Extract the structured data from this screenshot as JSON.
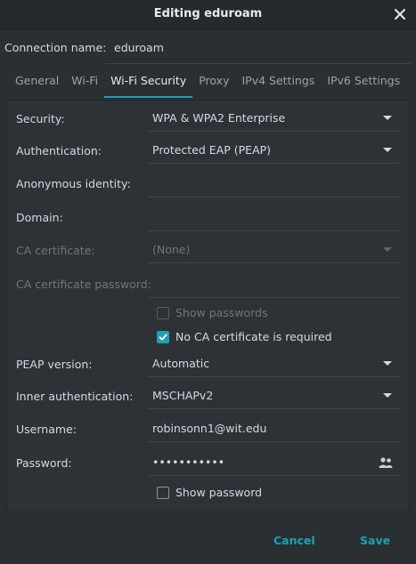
{
  "window": {
    "title": "Editing eduroam"
  },
  "connection": {
    "label": "Connection name:",
    "value": "eduroam"
  },
  "tabs": [
    {
      "label": "General"
    },
    {
      "label": "Wi-Fi"
    },
    {
      "label": "Wi-Fi Security"
    },
    {
      "label": "Proxy"
    },
    {
      "label": "IPv4 Settings"
    },
    {
      "label": "IPv6 Settings"
    }
  ],
  "form": {
    "security": {
      "label": "Security:",
      "value": "WPA & WPA2 Enterprise"
    },
    "authentication": {
      "label": "Authentication:",
      "value": "Protected EAP (PEAP)"
    },
    "anonymous_identity": {
      "label": "Anonymous identity:",
      "value": ""
    },
    "domain": {
      "label": "Domain:",
      "value": ""
    },
    "ca_certificate": {
      "label": "CA certificate:",
      "value": "(None)"
    },
    "ca_certificate_password": {
      "label": "CA certificate password:",
      "value": ""
    },
    "show_passwords": {
      "label": "Show passwords",
      "checked": false
    },
    "no_ca_required": {
      "label": "No CA certificate is required",
      "checked": true
    },
    "peap_version": {
      "label": "PEAP version:",
      "value": "Automatic"
    },
    "inner_authentication": {
      "label": "Inner authentication:",
      "value": "MSCHAPv2"
    },
    "username": {
      "label": "Username:",
      "value": "robinsonn1@wit.edu"
    },
    "password": {
      "label": "Password:",
      "value": "•••••••••••"
    },
    "show_password": {
      "label": "Show password",
      "checked": false
    }
  },
  "buttons": {
    "cancel": "Cancel",
    "save": "Save"
  },
  "colors": {
    "accent": "#1fa0b3",
    "background": "#2a2f33"
  }
}
